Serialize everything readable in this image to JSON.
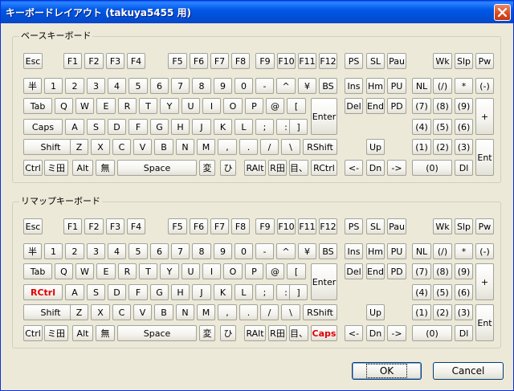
{
  "window": {
    "title": "キーボードレイアウト (takuya5455 用)"
  },
  "colors": {
    "title_bar": "#0058e6",
    "remapped_key_text": "#e00000",
    "background": "#ece9d8"
  },
  "groups": [
    {
      "label": "ベースキーボード",
      "keys": [
        "Esc",
        "F1",
        "F2",
        "F3",
        "F4",
        "F5",
        "F6",
        "F7",
        "F8",
        "F9",
        "F10",
        "F11",
        "F12",
        "PS",
        "SL",
        "Pau",
        "Wk",
        "Slp",
        "Pw",
        "半",
        "1",
        "2",
        "3",
        "4",
        "5",
        "6",
        "7",
        "8",
        "9",
        "0",
        "-",
        "^",
        "¥",
        "BS",
        "Ins",
        "Hm",
        "PU",
        "NL",
        "(/)",
        "*",
        "(-)",
        "Tab",
        "Q",
        "W",
        "E",
        "R",
        "T",
        "Y",
        "U",
        "I",
        "O",
        "P",
        "@",
        "[",
        "Enter",
        "Del",
        "End",
        "PD",
        "(7)",
        "(8)",
        "(9)",
        "+",
        "Caps",
        "A",
        "S",
        "D",
        "F",
        "G",
        "H",
        "J",
        "K",
        "L",
        ";",
        ":",
        "]",
        "(4)",
        "(5)",
        "(6)",
        "Shift",
        "Z",
        "X",
        "C",
        "V",
        "B",
        "N",
        "M",
        ",",
        ".",
        "/",
        "\\",
        "RShift",
        "Up",
        "(1)",
        "(2)",
        "(3)",
        "Ent",
        "Ctrl",
        "ミ田",
        "Alt",
        "無",
        "Space",
        "変",
        "ひ",
        "RAlt",
        "R田",
        "目、",
        "RCtrl",
        "<-",
        "Dn",
        "->",
        "(0)",
        "Dl"
      ]
    },
    {
      "label": "リマップキーボード",
      "keys": [
        "Esc",
        "F1",
        "F2",
        "F3",
        "F4",
        "F5",
        "F6",
        "F7",
        "F8",
        "F9",
        "F10",
        "F11",
        "F12",
        "PS",
        "SL",
        "Pau",
        "Wk",
        "Slp",
        "Pw",
        "半",
        "1",
        "2",
        "3",
        "4",
        "5",
        "6",
        "7",
        "8",
        "9",
        "0",
        "-",
        "^",
        "¥",
        "BS",
        "Ins",
        "Hm",
        "PU",
        "NL",
        "(/)",
        "*",
        "(-)",
        "Tab",
        "Q",
        "W",
        "E",
        "R",
        "T",
        "Y",
        "U",
        "I",
        "O",
        "P",
        "@",
        "[",
        "Enter",
        "Del",
        "End",
        "PD",
        "(7)",
        "(8)",
        "(9)",
        "+",
        "RCtrl",
        "A",
        "S",
        "D",
        "F",
        "G",
        "H",
        "J",
        "K",
        "L",
        ";",
        ":",
        "]",
        "(4)",
        "(5)",
        "(6)",
        "Shift",
        "Z",
        "X",
        "C",
        "V",
        "B",
        "N",
        "M",
        ",",
        ".",
        "/",
        "\\",
        "RShift",
        "Up",
        "(1)",
        "(2)",
        "(3)",
        "Ent",
        "Ctrl",
        "ミ田",
        "Alt",
        "無",
        "Space",
        "変",
        "ひ",
        "RAlt",
        "R田",
        "目、",
        "Caps",
        "<-",
        "Dn",
        "->",
        "(0)",
        "Dl"
      ],
      "remapped": [
        "RCtrl",
        "Caps"
      ]
    }
  ],
  "buttons": {
    "ok": "OK",
    "cancel": "Cancel"
  },
  "icons": {
    "close": "close-icon"
  }
}
